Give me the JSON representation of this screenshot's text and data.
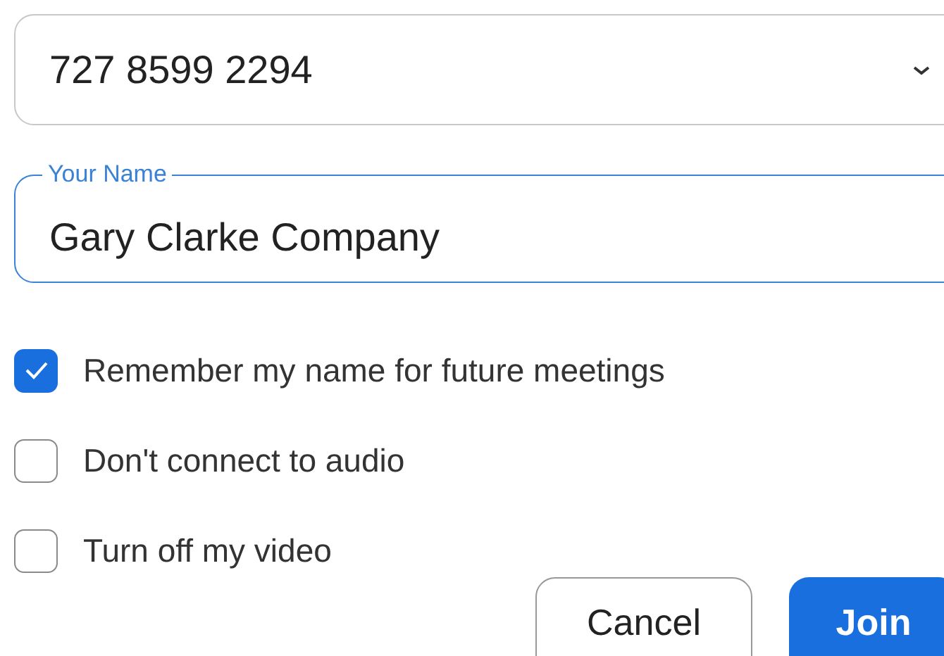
{
  "meeting_id": {
    "value": "727 8599 2294"
  },
  "name_field": {
    "label": "Your Name",
    "value": "Gary Clarke Company"
  },
  "options": [
    {
      "label": "Remember my name for future meetings",
      "checked": true
    },
    {
      "label": "Don't connect to audio",
      "checked": false
    },
    {
      "label": "Turn off my video",
      "checked": false
    }
  ],
  "buttons": [
    {
      "label": "Cancel",
      "kind": "secondary"
    },
    {
      "label": "Join",
      "kind": "primary"
    }
  ]
}
